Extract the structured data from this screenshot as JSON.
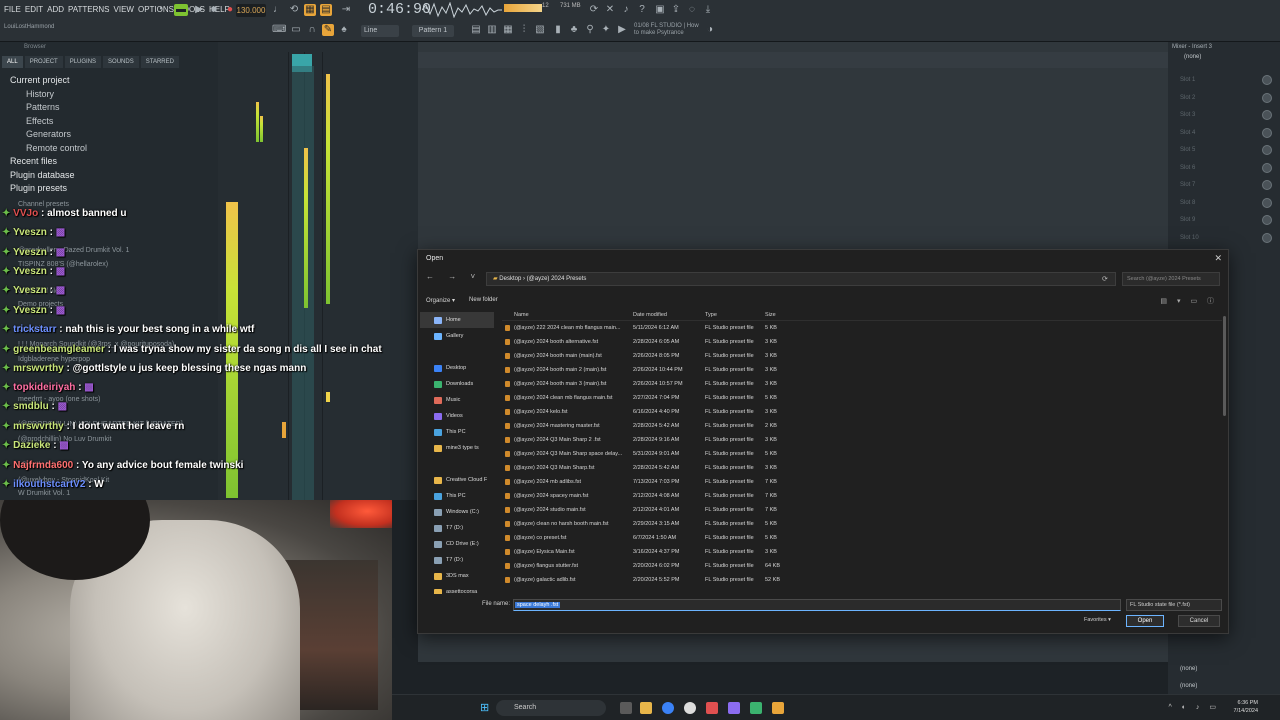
{
  "menu": [
    "FILE",
    "EDIT",
    "ADD",
    "PATTERNS",
    "VIEW",
    "OPTIONS",
    "TOOLS",
    "HELP"
  ],
  "user_name": "LouiLostHammond",
  "tempo": "130.000",
  "time": "0:46:90",
  "cpu": "12",
  "memory": "731 MB",
  "pattern_label": "Pattern 1",
  "snap_label": "Line",
  "hint": {
    "line1": "01/08  FL STUDIO | How",
    "line2": "to make Psytrance"
  },
  "browser": {
    "title": "Browser",
    "tabs": [
      "ALL",
      "PROJECT",
      "PLUGINS",
      "SOUNDS",
      "STARRED"
    ],
    "tree": [
      {
        "label": "Current project",
        "level": "top"
      },
      {
        "label": "History",
        "level": "ind"
      },
      {
        "label": "Patterns",
        "level": "ind"
      },
      {
        "label": "Effects",
        "level": "ind"
      },
      {
        "label": "Generators",
        "level": "ind"
      },
      {
        "label": "Remote control",
        "level": "ind"
      },
      {
        "label": "Recent files",
        "level": "top"
      },
      {
        "label": "Plugin database",
        "level": "top"
      },
      {
        "label": "Plugin presets",
        "level": "top"
      }
    ],
    "ghost_items": [
      "Channel presets",
      "@prodcullen - Dazed Drumkit Vol. 1",
      "TISPINZ 808'S (@hellarolex)",
      "Clipboard files",
      "Demo projects",
      "Drumkits",
      "! ! ! Monarch Soundkit (@3rps_x @pourituposoda)",
      "Idgbladerene hyperpop",
      "meedrrt - ayoo (one shots)",
      "(@PRODCHILLIN) KOLDHEARTED KIT [UPDATED]",
      "(@prodchillin) No Luv Drumkit",
      "(@ewify Fr)",
      "(@uxelyboy - StoopidKool Kit",
      "W Drumkit Vol. 1"
    ]
  },
  "chat": [
    {
      "user": "VVJo",
      "text": " : almost banned u",
      "color": "#e05050"
    },
    {
      "user": "Yveszn",
      "text": " :",
      "color": "#c9e67a"
    },
    {
      "user": "Yveszn",
      "text": " :",
      "color": "#c9e67a"
    },
    {
      "user": "Yveszn",
      "text": " :",
      "color": "#c9e67a"
    },
    {
      "user": "Yveszn",
      "text": " :",
      "color": "#c9e67a"
    },
    {
      "user": "Yveszn",
      "text": " :",
      "color": "#c9e67a"
    },
    {
      "user": "trickstarr",
      "text": " : nah this is your best song in a while wtf",
      "color": "#6c8fff"
    },
    {
      "user": "greenbeamgleamer",
      "text": " : I was tryna show my sister da song n dis all I see in chat",
      "color": "#c9e67a"
    },
    {
      "user": "mrswvrthy",
      "text": " : @gottlstyle u jus keep blessing these ngas mann",
      "color": "#c9e67a"
    },
    {
      "user": "topkideiriyah",
      "text": " :",
      "color": "#ff6fa3"
    },
    {
      "user": "smdblu",
      "text": " :",
      "color": "#c9e67a"
    },
    {
      "user": "mrswvrthy",
      "text": " : I dont want her leave rn",
      "color": "#c9e67a"
    },
    {
      "user": "Dazieke",
      "text": " :",
      "color": "#c9e67a"
    },
    {
      "user": "Najfrmda600",
      "text": " : Yo any advice bout female twinski",
      "color": "#ff7070"
    },
    {
      "user": "ilkouthstcartV2",
      "text": " : W",
      "color": "#6c8fff"
    }
  ],
  "mixer": {
    "title": "Mixer - Insert 3",
    "top_slot": "(none)",
    "slots": [
      "Slot 1",
      "Slot 2",
      "Slot 3",
      "Slot 4",
      "Slot 5",
      "Slot 6",
      "Slot 7",
      "Slot 8",
      "Slot 9",
      "Slot 10"
    ],
    "bottom_slots": [
      "(none)",
      "(none)"
    ]
  },
  "dialog": {
    "title": "Open",
    "breadcrumb": "Desktop  ›  (@ayze) 2024 Presets",
    "search_placeholder": "Search (@ayze) 2024 Presets",
    "organize": "Organize ▾",
    "new_folder": "New folder",
    "nav": [
      {
        "label": "Home",
        "color": "#8ab4f8",
        "sel": true
      },
      {
        "label": "Gallery",
        "color": "#6cb4ff"
      },
      {
        "label": "",
        "gap": true
      },
      {
        "label": "Desktop",
        "color": "#3b82f6"
      },
      {
        "label": "Downloads",
        "color": "#3bb36f"
      },
      {
        "label": "Music",
        "color": "#e06b5a"
      },
      {
        "label": "Videos",
        "color": "#8b6cf0"
      },
      {
        "label": "This PC",
        "color": "#4aa3df"
      },
      {
        "label": "mine3 type ts",
        "color": "#e8b64a"
      },
      {
        "label": "",
        "gap": true
      },
      {
        "label": "Creative Cloud F",
        "color": "#e8b64a"
      },
      {
        "label": "This PC",
        "color": "#4aa3df"
      },
      {
        "label": "Windows (C:)",
        "color": "#8aa0b4"
      },
      {
        "label": "T7 (D:)",
        "color": "#8aa0b4"
      },
      {
        "label": "CD Drive (E:)",
        "color": "#8aa0b4"
      },
      {
        "label": "T7 (D:)",
        "color": "#8aa0b4"
      },
      {
        "label": "3DS max",
        "color": "#e8b64a"
      },
      {
        "label": "assettocorsa",
        "color": "#e8b64a"
      }
    ],
    "columns": [
      "Name",
      "Date modified",
      "Type",
      "Size"
    ],
    "files": [
      [
        "(@ayze) 222 2024 clean mb flangus main...",
        "5/11/2024 6:12 AM",
        "FL Studio preset file",
        "5 KB"
      ],
      [
        "(@ayze) 2024 booth alternative.fst",
        "2/28/2024 6:05 AM",
        "FL Studio preset file",
        "3 KB"
      ],
      [
        "(@ayze) 2024 booth main (main).fst",
        "2/26/2024 8:05 PM",
        "FL Studio preset file",
        "3 KB"
      ],
      [
        "(@ayze) 2024 booth main 2 (main).fst",
        "2/26/2024 10:44 PM",
        "FL Studio preset file",
        "3 KB"
      ],
      [
        "(@ayze) 2024 booth main 3 (main).fst",
        "2/26/2024 10:57 PM",
        "FL Studio preset file",
        "3 KB"
      ],
      [
        "(@ayze) 2024 clean mb flangus main.fst",
        "2/27/2024 7:04 PM",
        "FL Studio preset file",
        "5 KB"
      ],
      [
        "(@ayze) 2024 kelo.fst",
        "6/16/2024 4:40 PM",
        "FL Studio preset file",
        "3 KB"
      ],
      [
        "(@ayze) 2024 mastering master.fst",
        "2/28/2024 5:42 AM",
        "FL Studio preset file",
        "2 KB"
      ],
      [
        "(@ayze) 2024 Q3 Main Sharp 2 .fst",
        "2/28/2024 9:16 AM",
        "FL Studio preset file",
        "3 KB"
      ],
      [
        "(@ayze) 2024 Q3 Main Sharp space delay...",
        "5/31/2024 9:01 AM",
        "FL Studio preset file",
        "5 KB"
      ],
      [
        "(@ayze) 2024 Q3 Main Sharp.fst",
        "2/28/2024 5:42 AM",
        "FL Studio preset file",
        "3 KB"
      ],
      [
        "(@ayze) 2024 mb adlibs.fst",
        "7/13/2024 7:03 PM",
        "FL Studio preset file",
        "7 KB"
      ],
      [
        "(@ayze) 2024 spacey main.fst",
        "2/12/2024 4:08 AM",
        "FL Studio preset file",
        "7 KB"
      ],
      [
        "(@ayze) 2024 studio main.fst",
        "2/12/2024 4:01 AM",
        "FL Studio preset file",
        "7 KB"
      ],
      [
        "(@ayze) clean no harsh booth main.fst",
        "2/29/2024 3:15 AM",
        "FL Studio preset file",
        "5 KB"
      ],
      [
        "(@ayze) co preset.fst",
        "6/7/2024 1:50 AM",
        "FL Studio preset file",
        "5 KB"
      ],
      [
        "(@ayze) Elysica Main.fst",
        "3/16/2024 4:37 PM",
        "FL Studio preset file",
        "3 KB"
      ],
      [
        "(@ayze) flangus stutter.fst",
        "2/20/2024 6:02 PM",
        "FL Studio preset file",
        "64 KB"
      ],
      [
        "(@ayze) galactic adlib.fst",
        "2/20/2024 5:52 PM",
        "FL Studio preset file",
        "52 KB"
      ]
    ],
    "file_name_label": "File name:",
    "file_name_value": "space delayh .fst",
    "file_type": "FL Studio state file (*.fst)",
    "favorites": "Favorites ▾",
    "open": "Open",
    "cancel": "Cancel"
  },
  "taskbar": {
    "search": "Search",
    "time": "6:36 PM",
    "date": "7/14/2024"
  }
}
